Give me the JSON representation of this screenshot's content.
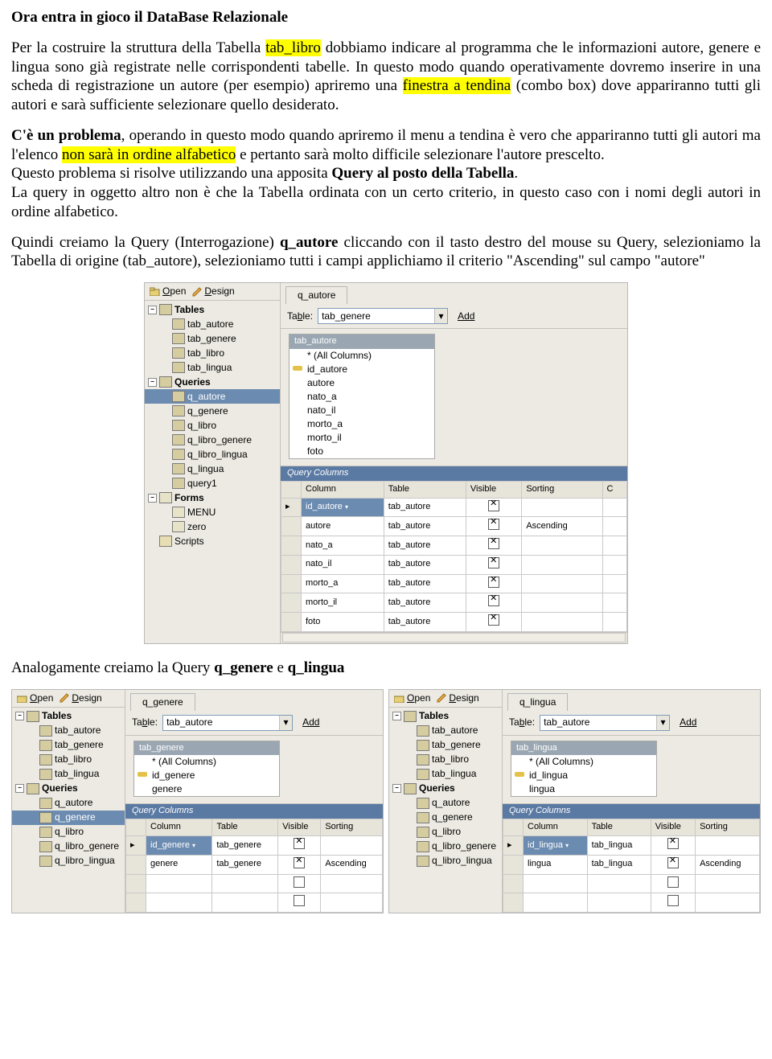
{
  "doc": {
    "title": "Ora entra in gioco il DataBase Relazionale",
    "para1_a": "Per la costruire la struttura della Tabella ",
    "para1_hl1": "tab_libro",
    "para1_b": " dobbiamo indicare al programma che le informazioni autore, genere e lingua sono già registrate nelle corrispondenti tabelle. In questo modo quando operativamente dovremo inserire in una scheda di registrazione un autore (per esempio) apriremo una ",
    "para1_hl2": "finestra a tendina",
    "para1_c": " (combo box) dove appariranno tutti gli autori e sarà sufficiente selezionare quello desiderato.",
    "para2_a": "C'è un problema",
    "para2_b": ", operando in questo modo quando apriremo il menu a tendina è vero che appariranno tutti gli autori ma l'elenco ",
    "para2_hl": "non sarà in ordine alfabetico",
    "para2_c": " e pertanto sarà molto difficile selezionare l'autore prescelto.",
    "para3_a": "Questo problema si risolve utilizzando una apposita ",
    "para3_b": "Query al posto della Tabella",
    "para3_c": ".",
    "para4": "La query in oggetto altro non è che la Tabella ordinata con un certo criterio, in questo caso con i nomi degli autori in ordine alfabetico.",
    "para5_a": "Quindi creiamo la Query (Interrogazione) ",
    "para5_b": "q_autore",
    "para5_c": " cliccando con il tasto destro del mouse su Query, selezioniamo la Tabella di origine (tab_autore), selezioniamo tutti i campi applichiamo il criterio \"Ascending\" sul campo \"autore\"",
    "para6_a": "Analogamente creiamo la Query ",
    "para6_b": "q_genere",
    "para6_c": " e ",
    "para6_d": "q_lingua"
  },
  "toolbar": {
    "open": "Open",
    "design": "Design"
  },
  "tree": {
    "tables": "Tables",
    "tab_autore": "tab_autore",
    "tab_genere": "tab_genere",
    "tab_libro": "tab_libro",
    "tab_lingua": "tab_lingua",
    "queries": "Queries",
    "q_autore": "q_autore",
    "q_genere": "q_genere",
    "q_libro": "q_libro",
    "q_libro_genere": "q_libro_genere",
    "q_libro_lingua": "q_libro_lingua",
    "q_lingua": "q_lingua",
    "query1": "query1",
    "forms": "Forms",
    "menu": "MENU",
    "zero": "zero",
    "scripts": "Scripts"
  },
  "designer": {
    "table_label": "Table:",
    "add": "Add",
    "qcols_title": "Query Columns",
    "headers": {
      "column": "Column",
      "table": "Table",
      "visible": "Visible",
      "sorting": "Sorting",
      "c": "C"
    },
    "ascending": "Ascending"
  },
  "q_autore": {
    "tab": "q_autore",
    "table_combo": "tab_genere",
    "fieldbox_title": "tab_autore",
    "fields": [
      "* (All Columns)",
      "id_autore",
      "autore",
      "nato_a",
      "nato_il",
      "morto_a",
      "morto_il",
      "foto"
    ],
    "key_field": "id_autore",
    "rows": [
      {
        "col": "id_autore",
        "tab": "tab_autore",
        "vis": true,
        "sort": "",
        "sel": true
      },
      {
        "col": "autore",
        "tab": "tab_autore",
        "vis": true,
        "sort": "Ascending"
      },
      {
        "col": "nato_a",
        "tab": "tab_autore",
        "vis": true,
        "sort": ""
      },
      {
        "col": "nato_il",
        "tab": "tab_autore",
        "vis": true,
        "sort": ""
      },
      {
        "col": "morto_a",
        "tab": "tab_autore",
        "vis": true,
        "sort": ""
      },
      {
        "col": "morto_il",
        "tab": "tab_autore",
        "vis": true,
        "sort": ""
      },
      {
        "col": "foto",
        "tab": "tab_autore",
        "vis": true,
        "sort": ""
      }
    ]
  },
  "q_genere": {
    "tab": "q_genere",
    "table_combo": "tab_autore",
    "fieldbox_title": "tab_genere",
    "fields": [
      "* (All Columns)",
      "id_genere",
      "genere"
    ],
    "key_field": "id_genere",
    "rows": [
      {
        "col": "id_genere",
        "tab": "tab_genere",
        "vis": true,
        "sort": "",
        "sel": true
      },
      {
        "col": "genere",
        "tab": "tab_genere",
        "vis": true,
        "sort": "Ascending"
      },
      {
        "col": "",
        "tab": "",
        "vis": false,
        "sort": ""
      },
      {
        "col": "",
        "tab": "",
        "vis": false,
        "sort": ""
      }
    ]
  },
  "q_lingua": {
    "tab": "q_lingua",
    "table_combo": "tab_autore",
    "fieldbox_title": "tab_lingua",
    "fields": [
      "* (All Columns)",
      "id_lingua",
      "lingua"
    ],
    "key_field": "id_lingua",
    "rows": [
      {
        "col": "id_lingua",
        "tab": "tab_lingua",
        "vis": true,
        "sort": "",
        "sel": true
      },
      {
        "col": "lingua",
        "tab": "tab_lingua",
        "vis": true,
        "sort": "Ascending"
      },
      {
        "col": "",
        "tab": "",
        "vis": false,
        "sort": ""
      },
      {
        "col": "",
        "tab": "",
        "vis": false,
        "sort": ""
      }
    ]
  }
}
